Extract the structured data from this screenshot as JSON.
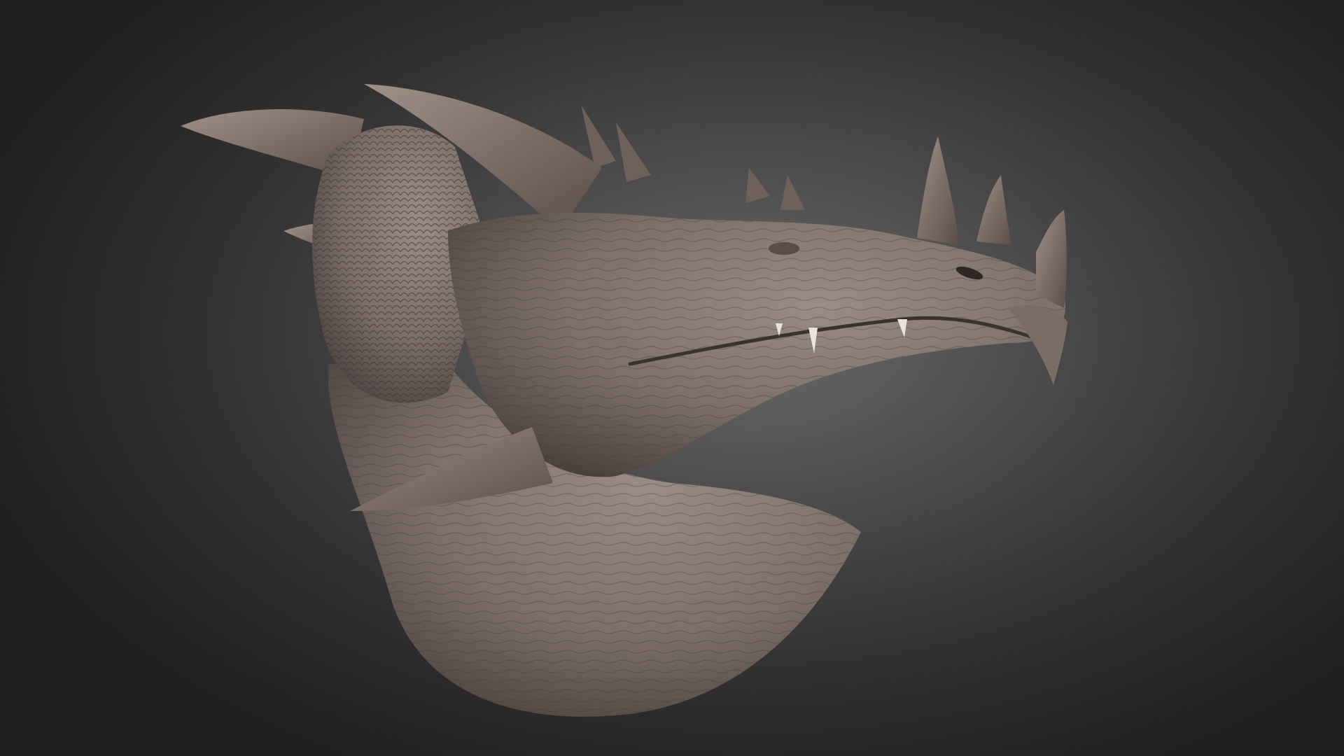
{
  "scene": {
    "subject": "dragon-head-sculpt",
    "background": {
      "center": "#6a6a6a",
      "mid": "#444444",
      "edge": "#1f1f1f"
    },
    "material": {
      "clay": "#7d706b",
      "clay_light": "#9a8c86",
      "clay_dark": "#4a3f3b",
      "teeth": "#e9e4dc"
    }
  }
}
